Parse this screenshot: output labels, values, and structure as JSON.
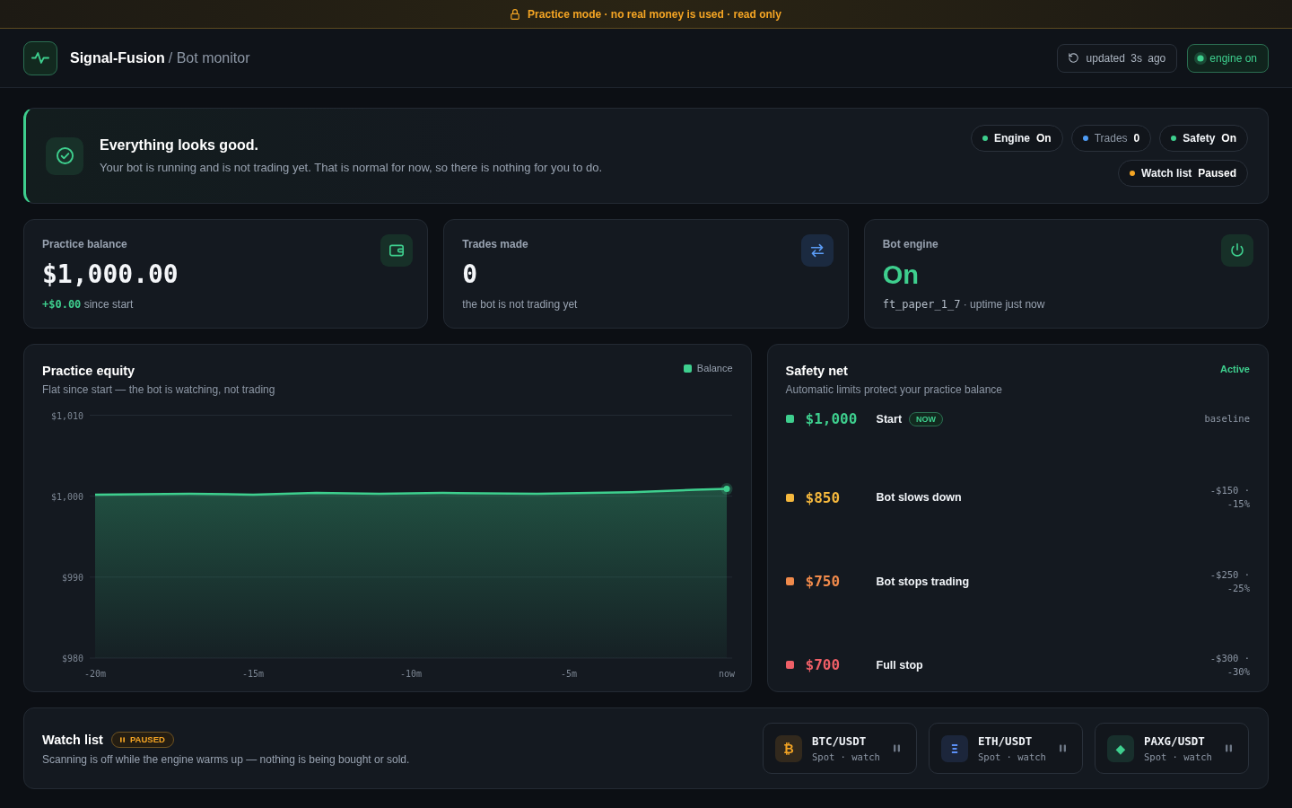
{
  "banner": {
    "text": "Practice mode · no real money is used · read only"
  },
  "header": {
    "brand": "Signal-Fusion",
    "page": "/ Bot monitor",
    "refresh": {
      "label": "updated 3s ago"
    },
    "engine": {
      "label": "engine on",
      "on": true
    }
  },
  "status": {
    "title": "Everything looks good.",
    "message": "Your bot is running and is not trading yet. That is normal for now, so there is nothing for you to do.",
    "chips": [
      {
        "label": "Engine",
        "value": "On",
        "color": "#3ecf8e",
        "muted": false
      },
      {
        "label": "Trades",
        "value": "0",
        "color": "#4f9cf5",
        "muted": true
      },
      {
        "label": "Safety",
        "value": "On",
        "color": "#3ecf8e",
        "muted": false
      },
      {
        "label": "Watch list",
        "value": "Paused",
        "color": "#f5a524",
        "muted": false
      }
    ]
  },
  "stats": [
    {
      "kind": "balance",
      "label": "Practice balance",
      "value": "$1,000.00",
      "note": [
        {
          "kind": "delta",
          "text": "+$0.00"
        },
        {
          "kind": "plain",
          "text": "since start"
        }
      ]
    },
    {
      "kind": "trades",
      "label": "Trades made",
      "value": "0",
      "note": [
        {
          "kind": "plain",
          "text": "the bot is not trading yet"
        }
      ]
    },
    {
      "kind": "engine",
      "label": "Bot engine",
      "value": "On",
      "note": [
        {
          "kind": "code",
          "text": "ft_paper_1_7"
        },
        {
          "kind": "plain",
          "text": "· uptime just now"
        }
      ]
    }
  ],
  "equity": {
    "subtitle": "Flat since start — the bot is watching, not trading",
    "chart_data": {
      "type": "area",
      "title": "Practice equity",
      "x": [
        -20,
        -17,
        -15,
        -13,
        -11,
        -9,
        -6,
        -3,
        -1,
        0
      ],
      "series": [
        {
          "name": "Balance",
          "color": "#3ecf8e",
          "values": [
            1000.2,
            1000.3,
            1000.2,
            1000.4,
            1000.3,
            1000.4,
            1000.3,
            1000.5,
            1000.8,
            1000.9
          ]
        }
      ],
      "xlim": [
        -20,
        0
      ],
      "ylim": [
        980,
        1010
      ],
      "xticks": [
        {
          "value": -20,
          "label": "-20m"
        },
        {
          "value": -15,
          "label": "-15m"
        },
        {
          "value": -10,
          "label": "-10m"
        },
        {
          "value": -5,
          "label": "-5m"
        },
        {
          "value": 0,
          "label": "now"
        }
      ],
      "yticks": [
        {
          "value": 1010,
          "label": "$1,010"
        },
        {
          "value": 1000,
          "label": "$1,000"
        },
        {
          "value": 990,
          "label": "$990"
        },
        {
          "value": 980,
          "label": "$980"
        }
      ]
    }
  },
  "safety_net": {
    "title": "Safety net",
    "status": "Active",
    "subtitle": "Automatic limits protect your practice balance",
    "levels": [
      {
        "amount": "$1,000",
        "label": "Start",
        "badge": "NOW",
        "note": "baseline",
        "color": "#3ecf8e"
      },
      {
        "amount": "$850",
        "label": "Bot slows down",
        "note": "-$150 · -15%",
        "color": "#f5b83d"
      },
      {
        "amount": "$750",
        "label": "Bot stops trading",
        "note": "-$250 · -25%",
        "color": "#f08a4b"
      },
      {
        "amount": "$700",
        "label": "Full stop",
        "note": "-$300 · -30%",
        "color": "#ef5f67"
      }
    ]
  },
  "watch_list": {
    "title": "Watch list",
    "badge": "PAUSED",
    "description": "Scanning is off while the engine warms up — nothing is being bought or sold.",
    "pairs": [
      {
        "glyph": "₿",
        "symbol": "BTC/USDT",
        "market": "Spot · watch",
        "color": "#f5a524"
      },
      {
        "glyph": "Ξ",
        "symbol": "ETH/USDT",
        "market": "Spot · watch",
        "color": "#5b8ff5"
      },
      {
        "glyph": "◆",
        "symbol": "PAXG/USDT",
        "market": "Spot · watch",
        "color": "#3ecf8e"
      }
    ]
  }
}
